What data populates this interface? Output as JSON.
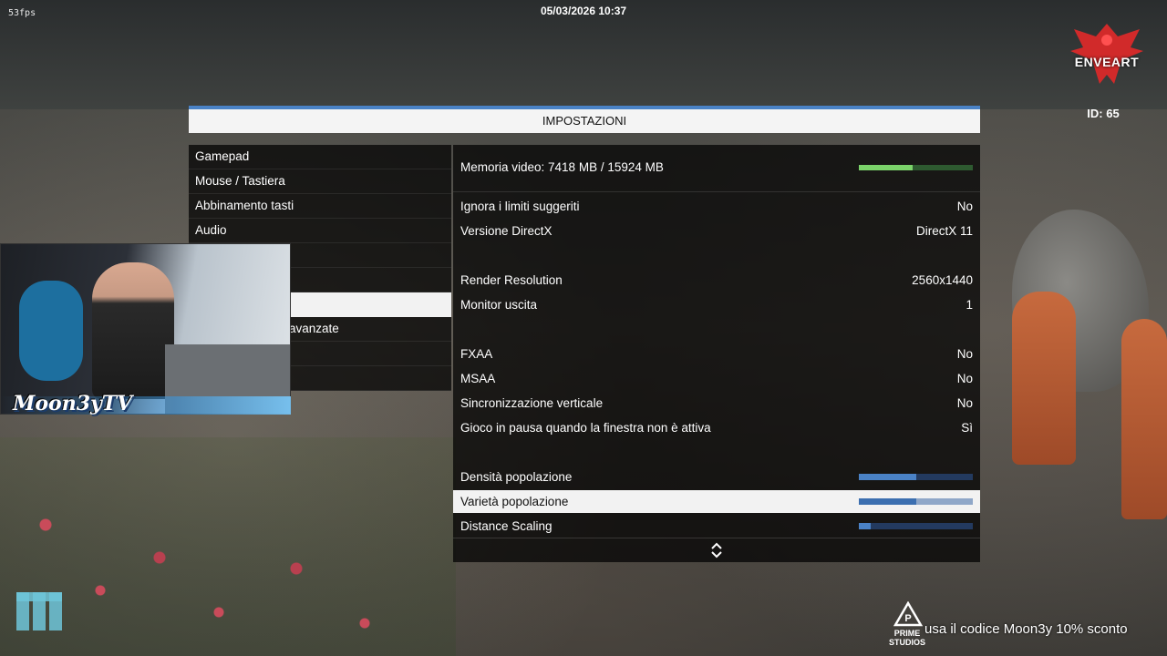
{
  "hud": {
    "fps": "53fps",
    "datetime": "05/03/2026 10:37",
    "brand": "ENVEART",
    "player_id": "ID: 65"
  },
  "settings": {
    "title": "IMPOSTAZIONI",
    "categories": [
      {
        "label": "Gamepad"
      },
      {
        "label": "Mouse / Tastiera"
      },
      {
        "label": "Abbinamento tasti"
      },
      {
        "label": "Audio"
      },
      {
        "label": ""
      },
      {
        "label": ""
      },
      {
        "label": ""
      },
      {
        "label": "avanzate"
      },
      {
        "label": ""
      },
      {
        "label": ""
      }
    ],
    "memory_label": "Memoria video: 7418 MB / 15924 MB",
    "memory_fraction": 0.47,
    "options": [
      {
        "label": "Ignora i limiti suggeriti",
        "value": "No"
      },
      {
        "label": "Versione DirectX",
        "value": "DirectX 11"
      },
      {
        "label": "Render Resolution",
        "value": "2560x1440"
      },
      {
        "label": "Monitor uscita",
        "value": "1"
      },
      {
        "label": "FXAA",
        "value": "No"
      },
      {
        "label": "MSAA",
        "value": "No"
      },
      {
        "label": "Sincronizzazione verticale",
        "value": "No"
      },
      {
        "label": "Gioco in pausa quando la finestra non è attiva",
        "value": "Sì"
      }
    ],
    "sliders": [
      {
        "label": "Densità popolazione",
        "level": 0.5
      },
      {
        "label": "Varietà popolazione",
        "level": 0.5
      },
      {
        "label": "Distance Scaling",
        "level": 0.1
      }
    ],
    "scroll_icon": "up-down-chevron-icon"
  },
  "overlay": {
    "streamer_name": "Moon3yTV",
    "sponsor": "PRIME STUDIOS",
    "promo_text": "usa il codice Moon3y 10% sconto",
    "logo_icon": "m-logo-icon"
  },
  "colors": {
    "accent": "#4a82c6",
    "vram_fill": "#7bd36a",
    "header_bg": "#f4f4f4"
  }
}
